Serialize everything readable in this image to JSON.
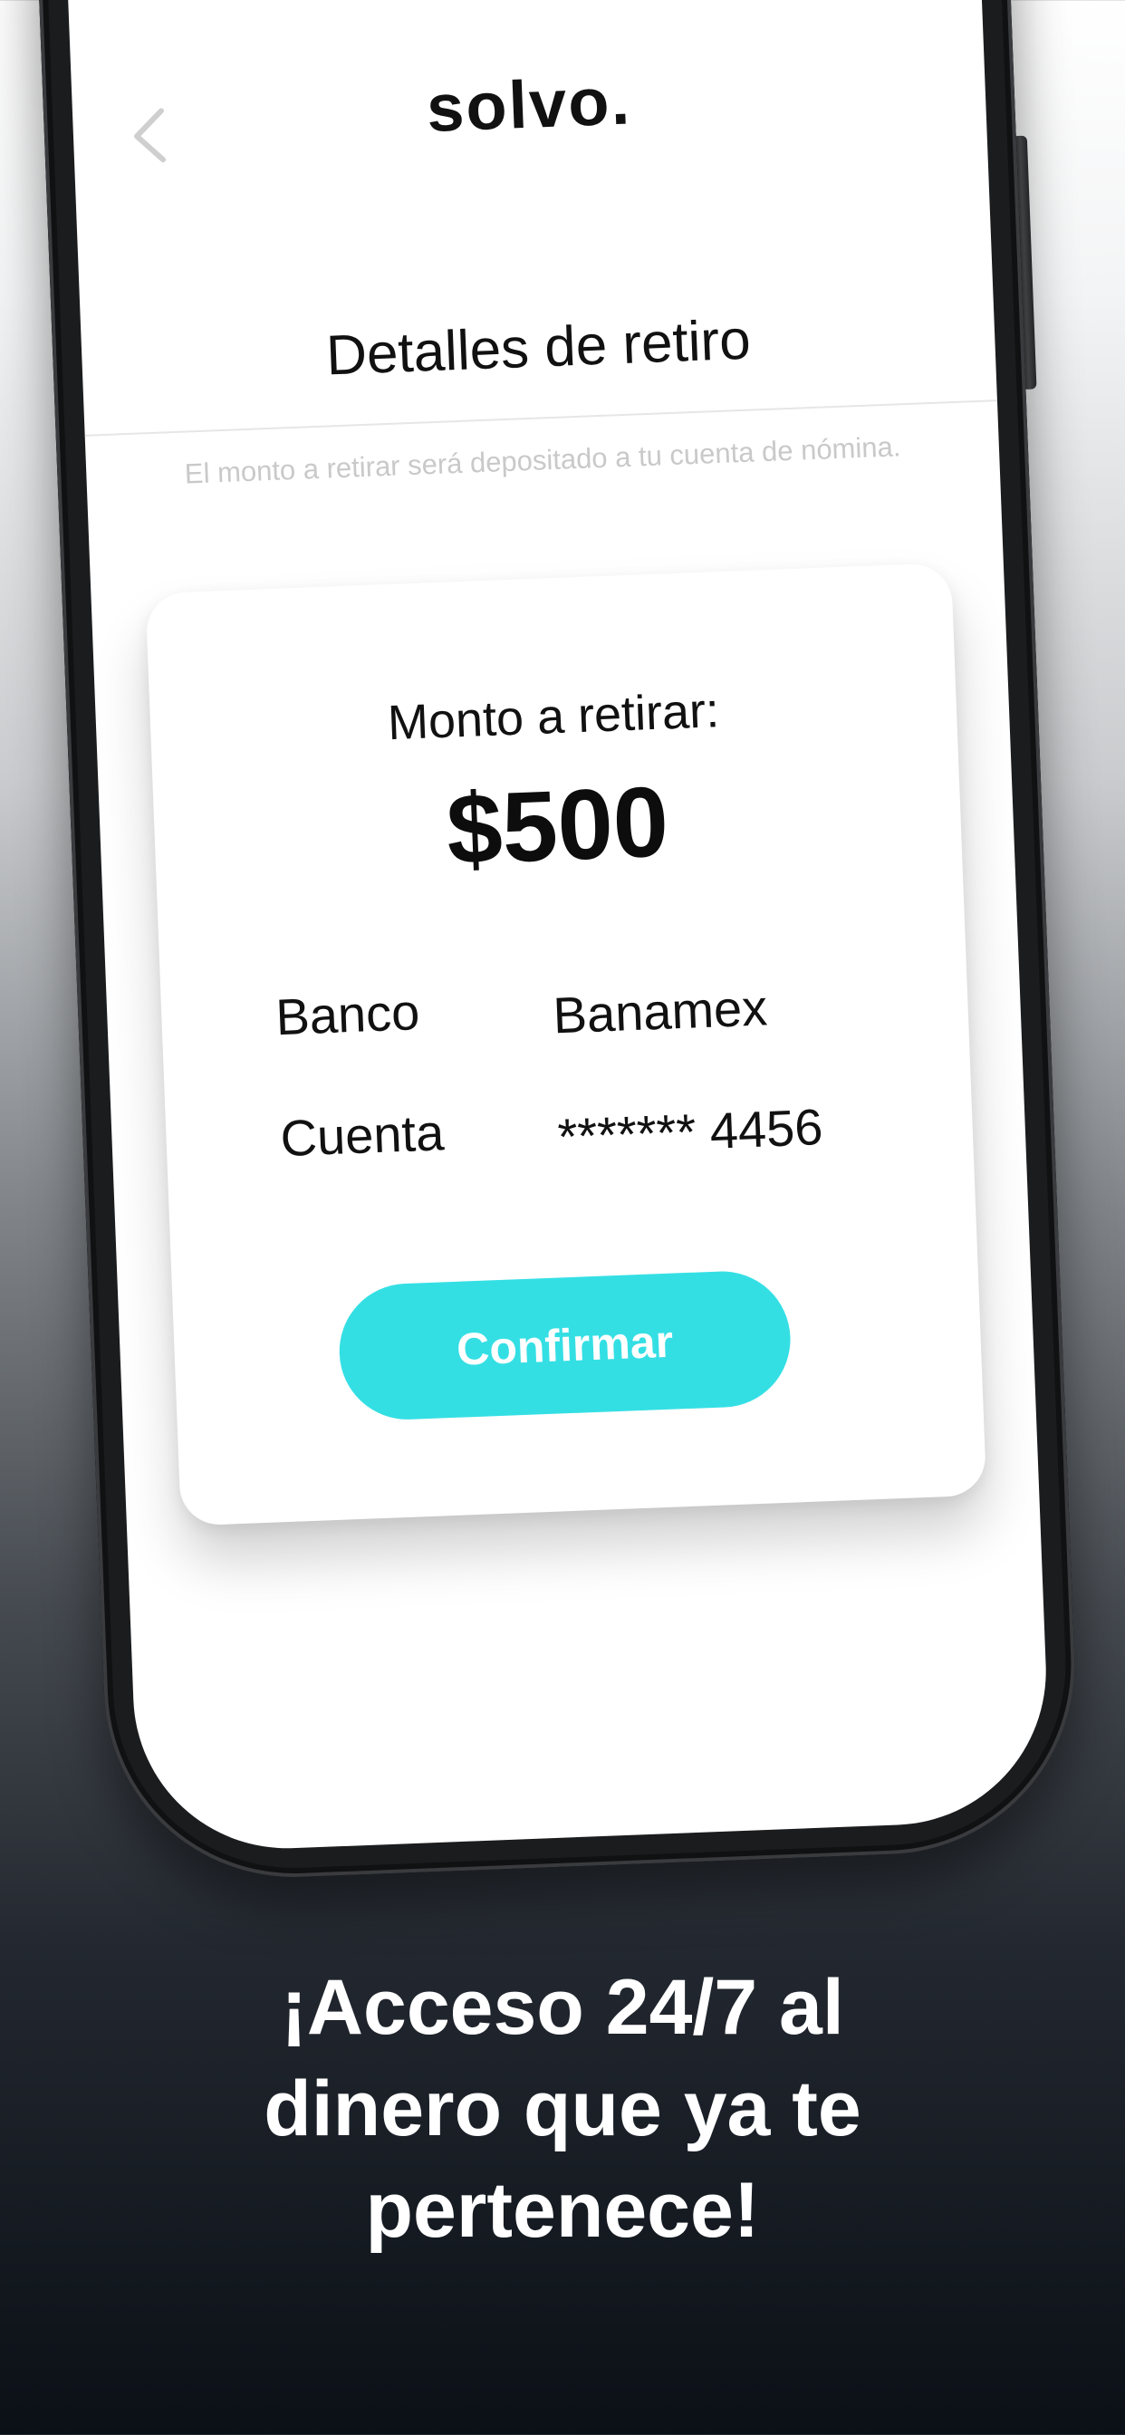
{
  "app": {
    "logo_text": "solvo.",
    "back_icon": "chevron-left-icon"
  },
  "header": {
    "title": "Detalles de retiro",
    "subtitle": "El monto a retirar será depositado a tu cuenta de nómina."
  },
  "withdrawal_card": {
    "amount_label": "Monto a retirar:",
    "amount": "$500",
    "bank_label": "Banco",
    "bank_value": "Banamex",
    "account_label": "Cuenta",
    "account_value": "******* 4456",
    "confirm_label": "Confirmar"
  },
  "promo": {
    "caption_line1": "¡Acceso 24/7 al",
    "caption_line2": "dinero que ya te",
    "caption_line3": "pertenece!"
  },
  "colors": {
    "accent": "#34dfe4",
    "text": "#111111",
    "muted": "#c9c9c9"
  }
}
